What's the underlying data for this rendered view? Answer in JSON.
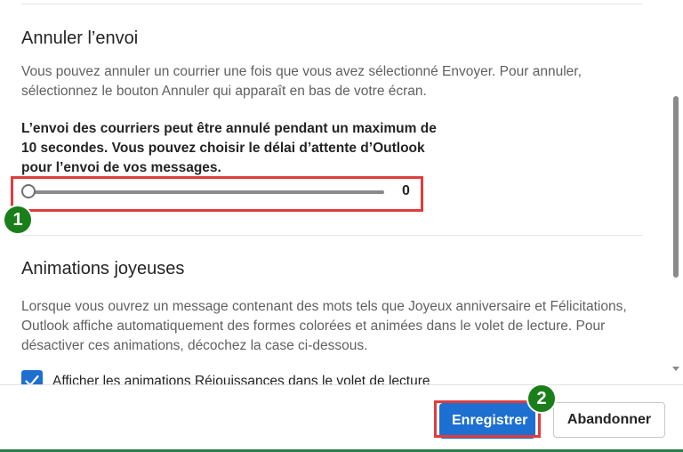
{
  "undo_send": {
    "title": "Annuler l’envoi",
    "description": "Vous pouvez annuler un courrier une fois que vous avez sélectionné Envoyer. Pour annuler, sélectionnez le bouton Annuler qui apparaît en bas de votre écran.",
    "limit_text": "L’envoi des courriers peut être annulé pendant un maximum de 10 secondes. Vous pouvez choisir le délai d’attente d’Outlook pour l’envoi de vos messages.",
    "slider": {
      "value": "0",
      "min": 0,
      "max": 10
    }
  },
  "animations": {
    "title": "Animations joyeuses",
    "description": "Lorsque vous ouvrez un message contenant des mots tels que Joyeux anniversaire et Félicitations, Outlook affiche automatiquement des formes colorées et animées dans le volet de lecture. Pour désactiver ces animations, décochez la case ci-dessous.",
    "checkbox_label": "Afficher les animations Réjouissances dans le volet de lecture",
    "checkbox_checked": true
  },
  "annotations": {
    "step1": "1",
    "step2": "2",
    "highlight_color": "#e03c3c",
    "badge_color": "#1a7f1a"
  },
  "footer": {
    "save_label": "Enregistrer",
    "discard_label": "Abandonner"
  },
  "colors": {
    "accent": "#1d6fd1",
    "text": "#242424",
    "muted_text": "#616161"
  },
  "icons": {
    "checkbox": "checkmark-icon",
    "scroll_down": "chevron-down-icon"
  }
}
